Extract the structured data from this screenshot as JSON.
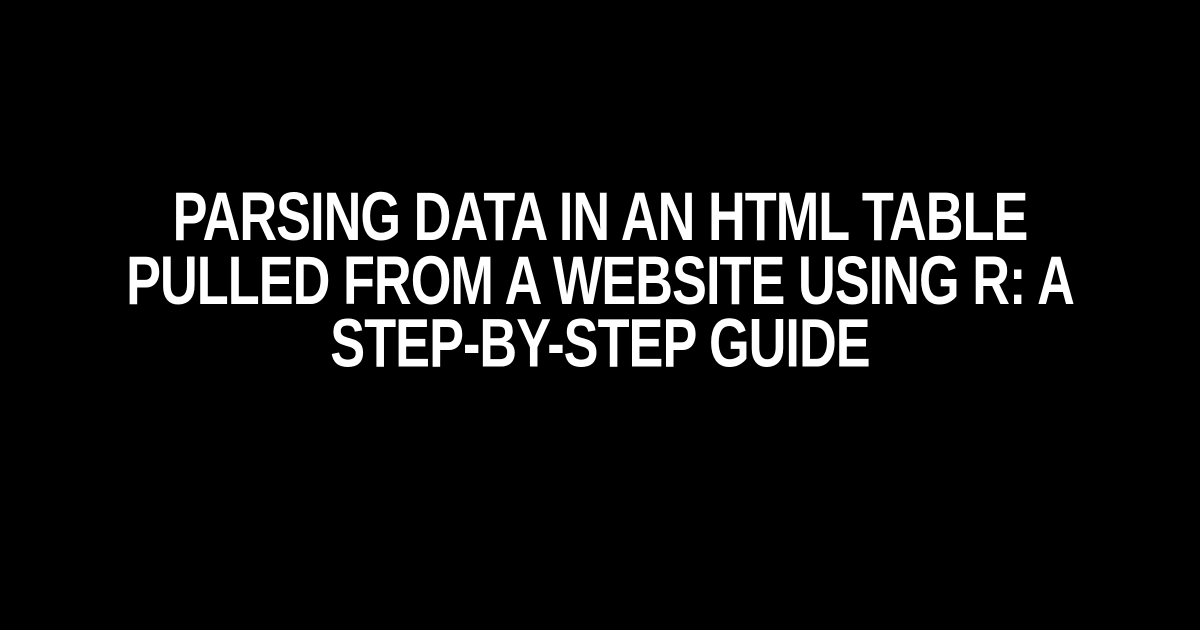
{
  "headline": "Parsing Data in an HTML Table Pulled from a Website using R: A Step-by-Step Guide"
}
